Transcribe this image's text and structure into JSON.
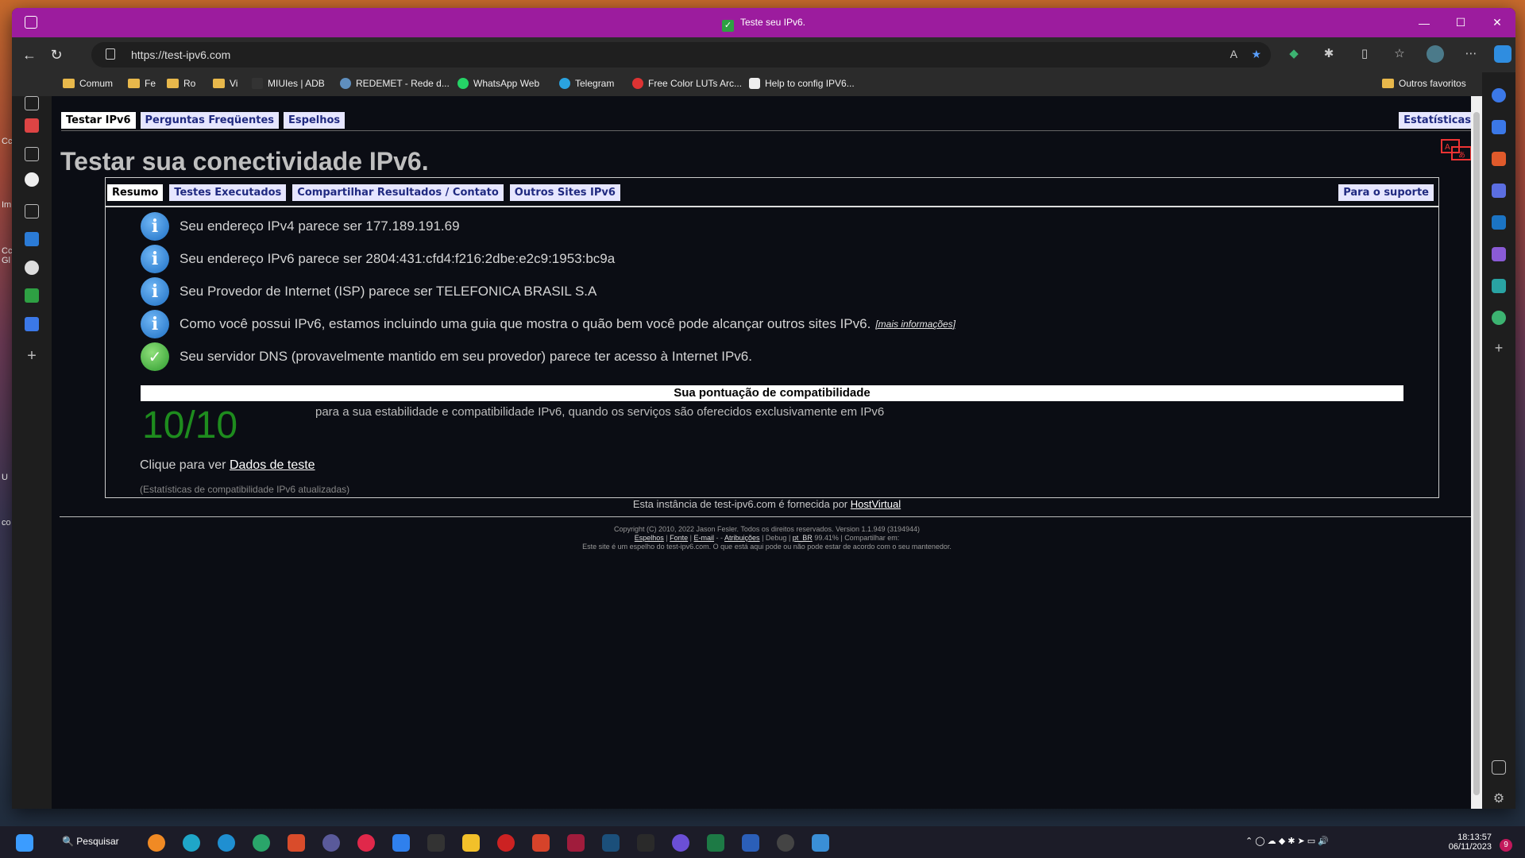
{
  "window": {
    "title": "Teste seu IPv6."
  },
  "address": {
    "url": "https://test-ipv6.com"
  },
  "bookmarks": [
    "Comum",
    "Fe",
    "Ro",
    "Vi",
    "MIUIes | ADB",
    "REDEMET - Rede d...",
    "WhatsApp Web",
    "Telegram",
    "Free Color LUTs Arc...",
    "Help to config IPV6..."
  ],
  "bookmarks_other": "Outros favoritos",
  "nav": {
    "tabs": [
      "Testar IPv6",
      "Perguntas Freqüentes",
      "Espelhos"
    ],
    "stats": "Estatísticas"
  },
  "page_title": "Testar sua conectividade IPv6.",
  "subtabs": {
    "items": [
      "Resumo",
      "Testes Executados",
      "Compartilhar Resultados / Contato",
      "Outros Sites IPv6"
    ],
    "support": "Para o suporte"
  },
  "messages": [
    {
      "icon": "info",
      "text": "Seu endereço IPv4 parece ser 177.189.191.69"
    },
    {
      "icon": "info",
      "text": "Seu endereço IPv6 parece ser 2804:431:cfd4:f216:2dbe:e2c9:1953:bc9a"
    },
    {
      "icon": "info",
      "text": "Seu Provedor de Internet (ISP) parece ser TELEFONICA BRASIL S.A"
    },
    {
      "icon": "info",
      "text": "Como você possui IPv6, estamos incluindo uma guia que mostra o quão bem você pode alcançar outros sites IPv6.",
      "link": "[mais informações]"
    },
    {
      "icon": "ok",
      "text": "Seu servidor DNS (provavelmente mantido em seu provedor) parece ter acesso à Internet IPv6."
    }
  ],
  "score": {
    "header": "Sua pontuação de compatibilidade",
    "value": "10/10",
    "desc": "para a sua estabilidade e compatibilidade IPv6, quando os serviços são oferecidos exclusivamente em IPv6"
  },
  "click": {
    "prefix": "Clique para ver",
    "link": "Dados de teste"
  },
  "updated": "(Estatísticas de compatibilidade IPv6 atualizadas)",
  "hosted": {
    "prefix": "Esta instância de test-ipv6.com é fornecida por",
    "link": "HostVirtual"
  },
  "footer": {
    "copyright": "Copyright (C) 2010, 2022 Jason Fesler. Todos os direitos reservados. Version 1.1.949 (3194944)",
    "links": [
      "Espelhos",
      "Fonte",
      "E-mail",
      "Atribuições",
      "Debug",
      "pt_BR"
    ],
    "percent": "99.41%",
    "share": "Compartilhar em:",
    "mirror_note": "Este site é um espelho do test-ipv6.com. O que está aqui pode ou não pode estar de acordo com o seu mantenedor."
  },
  "taskbar": {
    "search": "Pesquisar",
    "time": "18:13:57",
    "date": "06/11/2023",
    "notifications": "9"
  },
  "colors": {
    "titlebar": "#9c1c9e",
    "score": "#1e8c1e",
    "info": "#1e6fc4",
    "ok": "#2d9b2d"
  }
}
